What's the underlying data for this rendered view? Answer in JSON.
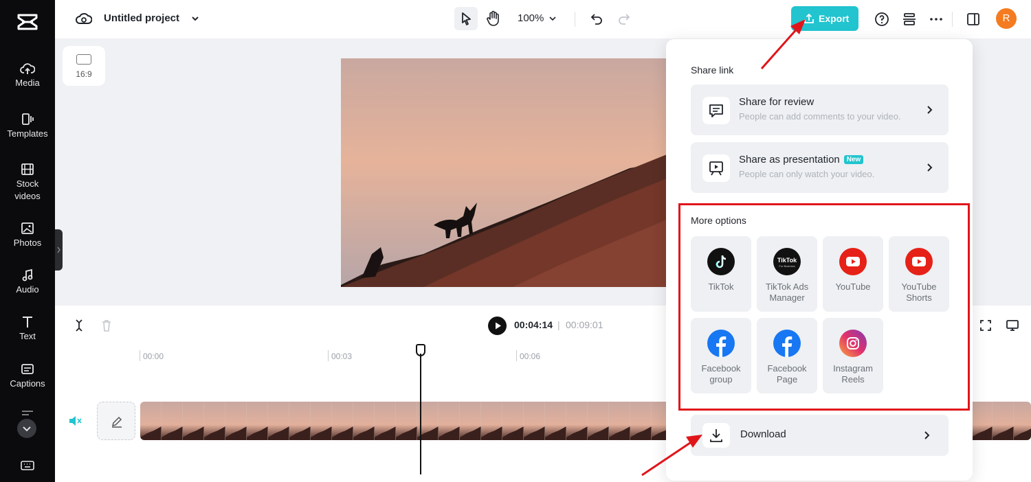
{
  "sidebar": {
    "items": [
      {
        "label": "Media",
        "icon": "cloud-upload-icon"
      },
      {
        "label": "Templates",
        "icon": "templates-icon"
      },
      {
        "label": "Stock videos",
        "icon": "film-icon"
      },
      {
        "label": "Photos",
        "icon": "image-icon"
      },
      {
        "label": "Audio",
        "icon": "music-note-icon"
      },
      {
        "label": "Text",
        "icon": "text-t-icon"
      },
      {
        "label": "Captions",
        "icon": "captions-icon"
      }
    ]
  },
  "header": {
    "project_title": "Untitled project",
    "zoom": "100%",
    "export_label": "Export",
    "avatar_initial": "R"
  },
  "canvas": {
    "aspect_ratio": "16:9"
  },
  "timeline": {
    "current_time": "00:04:14",
    "separator": "|",
    "total_time": "00:09:01",
    "ruler_labels": [
      "00:00",
      "00:03",
      "00:06"
    ]
  },
  "export_panel": {
    "share_link_title": "Share link",
    "share_review": {
      "title": "Share for review",
      "subtitle": "People can add comments to your video."
    },
    "share_presentation": {
      "title": "Share as presentation",
      "badge": "New",
      "subtitle": "People can only watch your video."
    },
    "more_options_title": "More options",
    "options": [
      {
        "label": "TikTok",
        "icon": "tiktok-icon",
        "color": "#111111"
      },
      {
        "label": "TikTok Ads Manager",
        "icon": "tiktok-ads-icon",
        "color": "#111111"
      },
      {
        "label": "YouTube",
        "icon": "youtube-icon",
        "color": "#e62117"
      },
      {
        "label": "YouTube Shorts",
        "icon": "youtube-shorts-icon",
        "color": "#e62117"
      },
      {
        "label": "Facebook group",
        "icon": "facebook-icon",
        "color": "#1877f2"
      },
      {
        "label": "Facebook Page",
        "icon": "facebook-icon",
        "color": "#1877f2"
      },
      {
        "label": "Instagram Reels",
        "icon": "instagram-icon",
        "color": "#d6249f"
      }
    ],
    "tiktok_ads_logo_text": "TikTok",
    "tiktok_ads_logo_sub": "For Business",
    "download_label": "Download"
  },
  "colors": {
    "accent": "#21c4cf",
    "annotation_red": "#e0151a",
    "avatar": "#f47b20"
  }
}
